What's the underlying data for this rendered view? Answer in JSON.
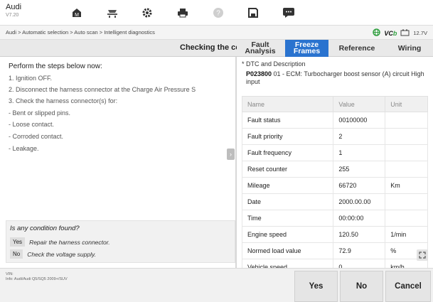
{
  "app": {
    "name": "Audi",
    "version": "V7.20"
  },
  "toolbar": {
    "icons": [
      "home-icon",
      "vehicle-lift-icon",
      "gear-icon",
      "printer-icon",
      "help-icon",
      "save-icon",
      "message-icon"
    ]
  },
  "breadcrumb": "Audi > Automatic selection > Auto scan > Intelligent diagnostics",
  "status": {
    "vci_label": "VC",
    "voltage": "12.7V"
  },
  "header": {
    "title": "Checking the co"
  },
  "tabs": [
    {
      "label_line1": "Fault",
      "label_line2": "Analysis",
      "active": false
    },
    {
      "label_line1": "Freeze",
      "label_line2": "Frames",
      "active": true
    },
    {
      "label": "Reference",
      "active": false
    },
    {
      "label": "Wiring",
      "active": false
    }
  ],
  "steps": {
    "title": "Perform the steps below now:",
    "items": [
      "1. Ignition OFF.",
      "2. Disconnect the harness connector at the Charge Air Pressure S",
      "3. Check the harness connector(s) for:",
      "- Bent or slipped pins.",
      "- Loose contact.",
      "- Corroded contact.",
      "- Leakage."
    ]
  },
  "question": {
    "title": "Is any condition found?",
    "options": [
      {
        "tag": "Yes",
        "text": "Repair the harness connector."
      },
      {
        "tag": "No",
        "text": "Check the voltage supply."
      }
    ]
  },
  "dtc": {
    "header": "* DTC and Description",
    "code": "P023800",
    "description": " 01 - ECM: Turbocharger boost sensor (A) circuit High input"
  },
  "table": {
    "columns": [
      "Name",
      "Value",
      "Unit"
    ],
    "rows": [
      [
        "Fault status",
        "00100000",
        ""
      ],
      [
        "Fault priority",
        "2",
        ""
      ],
      [
        "Fault frequency",
        "1",
        ""
      ],
      [
        "Reset counter",
        "255",
        ""
      ],
      [
        "Mileage",
        "66720",
        "Km"
      ],
      [
        "Date",
        "2000.00.00",
        ""
      ],
      [
        "Time",
        "00:00:00",
        ""
      ],
      [
        "Engine speed",
        "120.50",
        "1/min"
      ],
      [
        "Normed load value",
        "72.9",
        "%"
      ],
      [
        "Vehicle speed",
        "0",
        "km/h"
      ]
    ]
  },
  "footer": {
    "vin_label": "VIN:",
    "info": "Info: Audi/Audi Q5/SQ5 2009+/SUV",
    "yes": "Yes",
    "no": "No",
    "cancel": "Cancel"
  },
  "colors": {
    "accent": "#2a73cf",
    "vcb_green": "#2e9f3e"
  }
}
